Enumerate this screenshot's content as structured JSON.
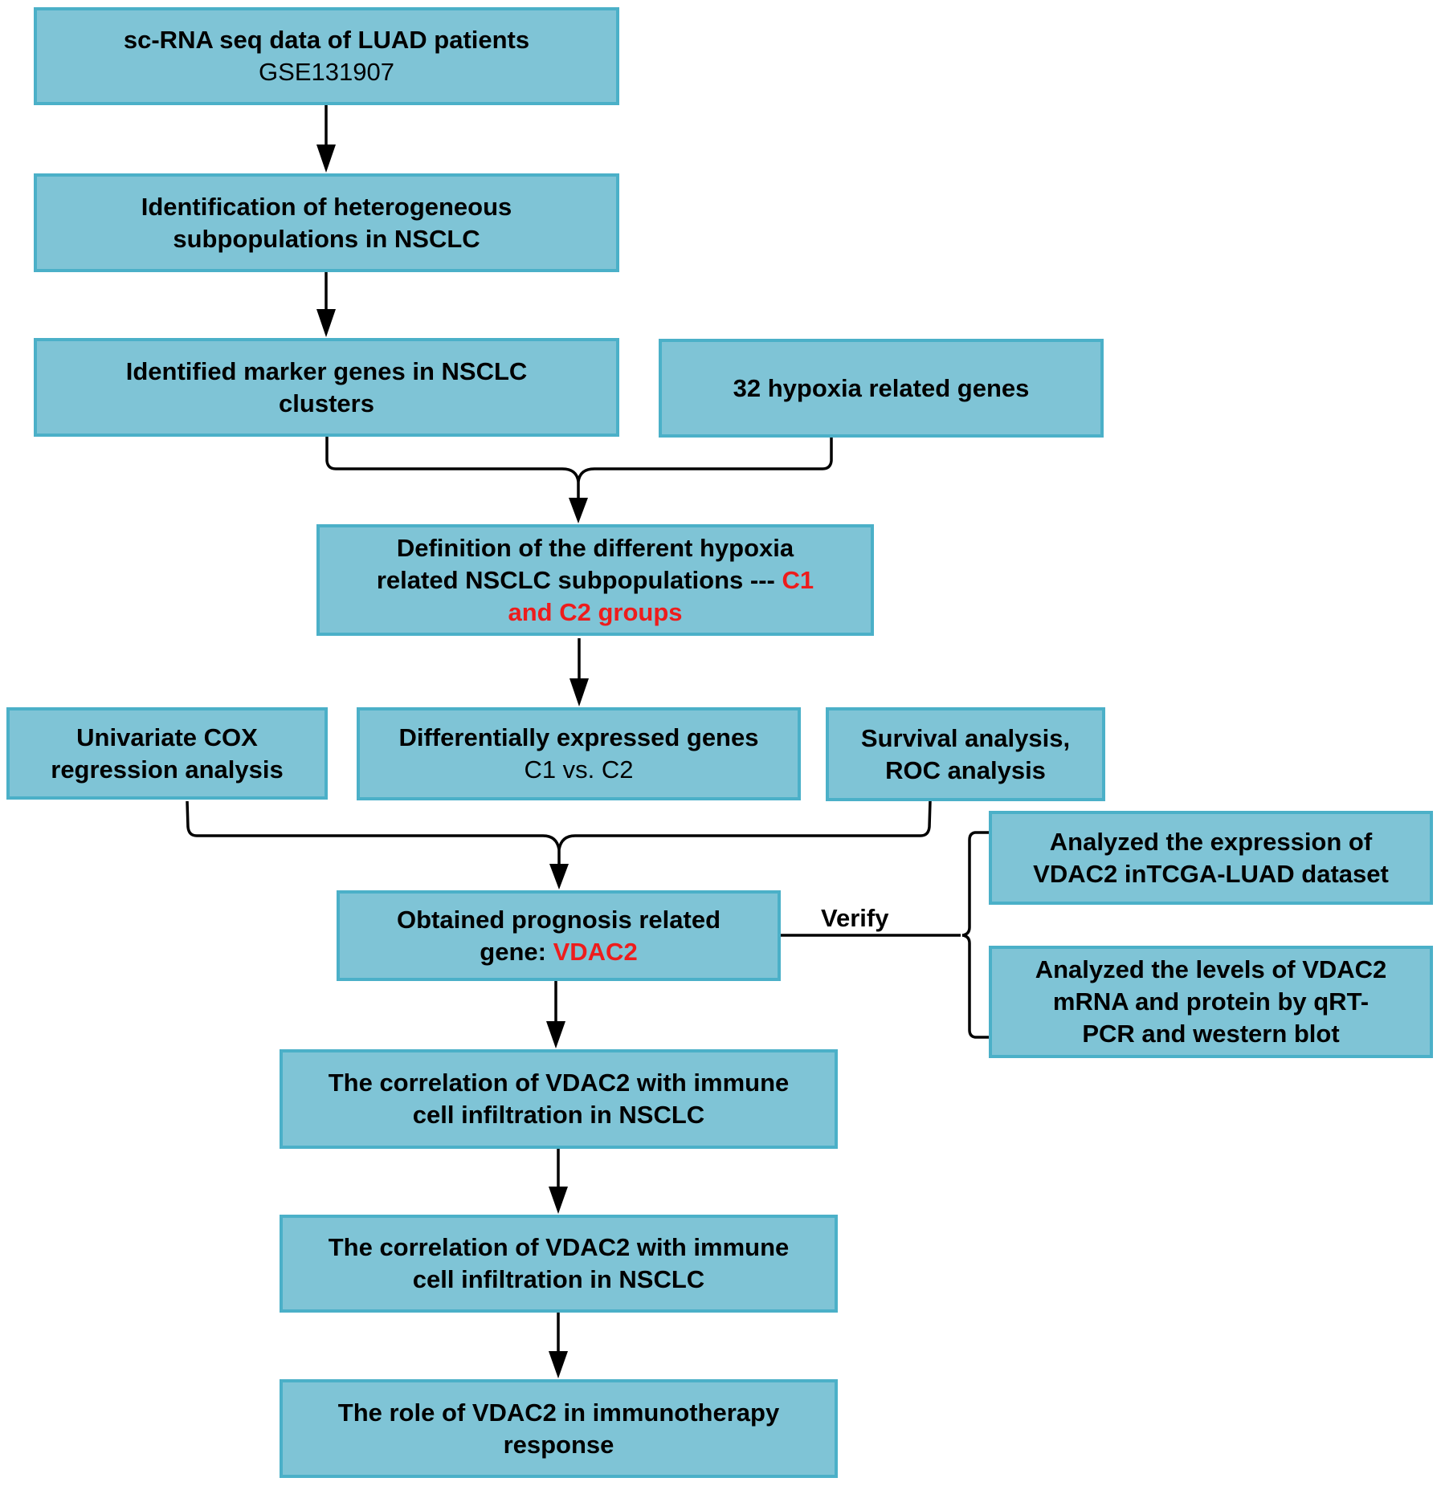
{
  "diagram": {
    "colors": {
      "box_fill": "#7fc4d6",
      "box_border": "#4bb0c8",
      "highlight": "#ee1c1c",
      "arrow": "#000000"
    },
    "nodes": {
      "scrna": {
        "title": "sc-RNA seq data of LUAD patients",
        "subtitle": "GSE131907"
      },
      "heterogeneous": {
        "title": "Identification of heterogeneous subpopulations in NSCLC"
      },
      "marker_genes": {
        "title": "Identified marker genes in NSCLC clusters"
      },
      "hypoxia_genes": {
        "title": "32 hypoxia related genes"
      },
      "definition": {
        "title": "Definition of the different hypoxia related NSCLC subpopulations ---",
        "highlight": "C1 and C2 groups"
      },
      "univariate_cox": {
        "title": "Univariate COX regression analysis"
      },
      "deg": {
        "title": "Differentially expressed genes",
        "subtitle": "C1 vs. C2"
      },
      "survival_roc": {
        "title": "Survival analysis, ROC analysis"
      },
      "prognosis_gene": {
        "title": "Obtained prognosis related gene:",
        "highlight": "VDAC2"
      },
      "tcga_expression": {
        "title": "Analyzed the expression of VDAC2 inTCGA-LUAD dataset"
      },
      "qrt_pcr": {
        "title": "Analyzed the levels of VDAC2 mRNA and protein by qRT-PCR and western blot"
      },
      "immune_corr_1": {
        "title": "The correlation of  VDAC2 with immune cell infiltration in NSCLC"
      },
      "immune_corr_2": {
        "title": "The correlation of  VDAC2 with immune cell infiltration in NSCLC"
      },
      "immunotherapy": {
        "title": "The role of VDAC2 in immunotherapy response"
      }
    },
    "edge_labels": {
      "verify": "Verify"
    }
  }
}
